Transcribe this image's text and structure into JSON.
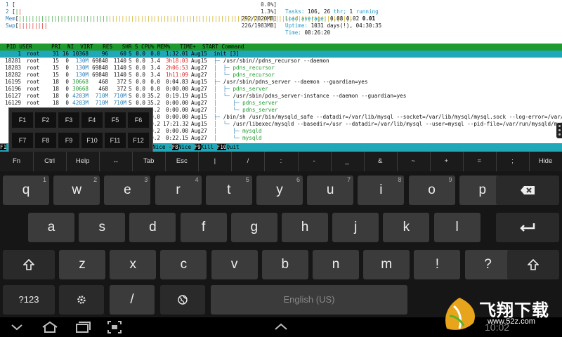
{
  "terminal": {
    "meters": [
      {
        "label": "1",
        "open": " [",
        "green": "",
        "red": "",
        "yellow": "",
        "close": "",
        "value": "0.0%]"
      },
      {
        "label": "2",
        "open": " [",
        "green": "|",
        "red": "|",
        "yellow": "",
        "close": "",
        "value": "1.3%]"
      },
      {
        "label": "Mem",
        "open": "[",
        "green": "||||||||||||||||||||||||||||",
        "red": "",
        "yellow": "||||||||||||||||||||||||||||||||||||||||||||||||||||||||||||||||||||||||||||",
        "close": "",
        "value": "292/2020MB]"
      },
      {
        "label": "Swp",
        "open": "[",
        "green": "",
        "red": "|||||||||",
        "yellow": "",
        "close": "",
        "value": "226/1983MB]"
      }
    ],
    "stats": {
      "tasks_label": "Tasks:",
      "tasks_value": "106,",
      "thr_value": "26",
      "thr_label": "thr;",
      "running_value": "1",
      "running_label": "running",
      "load_label": "Load average:",
      "load_values": "0.08 0.02",
      "load_last": "0.01",
      "uptime_label": "Uptime:",
      "uptime_value": "1031 days(!), 04:30:35",
      "time_label": "Time:",
      "time_value": "08:26:20"
    },
    "header": "  PID USER      PRI  NI  VIRT   RES   SHR S CPU% MEM%   TIME+  START Command",
    "processes": [
      {
        "pid": "1",
        "user": "root",
        "pri": "31",
        "ni": "16",
        "virt": "10368",
        "res": "96",
        "shr": "60",
        "s": "S",
        "cpu": "0.0",
        "mem": "0.0",
        "time": "1:32.01",
        "start": "Aug15",
        "cmd": "init [3]",
        "selected": true
      },
      {
        "pid": "18281",
        "user": "root",
        "pri": "15",
        "ni": "0",
        "virt": "130M",
        "res": "69848",
        "shr": "1140",
        "s": "S",
        "cpu": "0.0",
        "mem": "3.4",
        "time": "3h18:03",
        "start": "Aug15",
        "cmd": "/usr/sbin//pdns_recursor --daemon",
        "tree": "├─ "
      },
      {
        "pid": "18283",
        "user": "root",
        "pri": "15",
        "ni": "0",
        "virt": "130M",
        "res": "69848",
        "shr": "1140",
        "s": "S",
        "cpu": "0.0",
        "mem": "3.4",
        "time": "2h06:53",
        "start": "Aug27",
        "cmd": "pdns_recursor",
        "tree": "│  ├─ ",
        "green": true
      },
      {
        "pid": "18282",
        "user": "root",
        "pri": "15",
        "ni": "0",
        "virt": "130M",
        "res": "69848",
        "shr": "1140",
        "s": "S",
        "cpu": "0.0",
        "mem": "3.4",
        "time": "1h11:09",
        "start": "Aug27",
        "cmd": "pdns_recursor",
        "tree": "│  └─ ",
        "green": true
      },
      {
        "pid": "16195",
        "user": "root",
        "pri": "18",
        "ni": "0",
        "virt": "30668",
        "res": "468",
        "shr": "372",
        "s": "S",
        "cpu": "0.0",
        "mem": "0.0",
        "time": "0:04.83",
        "start": "Aug15",
        "cmd": "/usr/sbin/pdns_server --daemon --guardian=yes",
        "tree": "├─ "
      },
      {
        "pid": "16196",
        "user": "root",
        "pri": "18",
        "ni": "0",
        "virt": "30668",
        "res": "468",
        "shr": "372",
        "s": "S",
        "cpu": "0.0",
        "mem": "0.0",
        "time": "0:00.00",
        "start": "Aug27",
        "cmd": "pdns_server",
        "tree": "│  ├─ ",
        "green": true
      },
      {
        "pid": "16127",
        "user": "root",
        "pri": "18",
        "ni": "0",
        "virt": "4203M",
        "res": "710M",
        "shr": "710M",
        "s": "S",
        "cpu": "0.0",
        "mem": "35.2",
        "time": "0:19.19",
        "start": "Aug15",
        "cmd": "/usr/sbin/pdns_server-instance --daemon --guardian=yes",
        "tree": "│  └─ "
      },
      {
        "pid": "16129",
        "user": "root",
        "pri": "18",
        "ni": "0",
        "virt": "4203M",
        "res": "710M",
        "shr": "710M",
        "s": "S",
        "cpu": "0.0",
        "mem": "35.2",
        "time": "0:00.00",
        "start": "Aug27",
        "cmd": "pdns_server",
        "tree": "│     ├─ ",
        "green": true
      },
      {
        "pid": "",
        "user": "",
        "pri": "",
        "ni": "",
        "virt": "",
        "res": "",
        "shr": "",
        "s": "",
        "cpu": "",
        "mem": "35.2",
        "time": "0:00.00",
        "start": "Aug27",
        "cmd": "pdns_server",
        "tree": "│     └─ ",
        "green": true
      },
      {
        "pid": "",
        "user": "",
        "pri": "",
        "ni": "",
        "virt": "",
        "res": "",
        "shr": "",
        "s": "",
        "cpu": "",
        "mem": "0.0",
        "time": "0:00.00",
        "start": "Aug15",
        "cmd": "/bin/sh /usr/bin/mysqld_safe --datadir=/var/lib/mysql --socket=/var/lib/mysql/mysql.sock --log-error=/var/log/",
        "tree": "├─ "
      },
      {
        "pid": "",
        "user": "",
        "pri": "",
        "ni": "",
        "virt": "",
        "res": "",
        "shr": "",
        "s": "",
        "cpu": "",
        "mem": "0.2",
        "time": "17:21.32",
        "start": "Aug15",
        "cmd": "/usr/libexec/mysqld --basedir=/usr --datadir=/var/lib/mysql --user=mysql --pid-file=/var/run/mysqld/mysqld",
        "tree": "│  └─ "
      },
      {
        "pid": "",
        "user": "",
        "pri": "",
        "ni": "",
        "virt": "",
        "res": "",
        "shr": "",
        "s": "",
        "cpu": "",
        "mem": "0.2",
        "time": "0:00.00",
        "start": "Aug27",
        "cmd": "mysqld",
        "tree": "│     ├─ ",
        "green": true
      },
      {
        "pid": "",
        "user": "",
        "pri": "",
        "ni": "",
        "virt": "",
        "res": "",
        "shr": "",
        "s": "",
        "cpu": "",
        "mem": "0.2",
        "time": "0:22.15",
        "start": "Aug27",
        "cmd": "mysqld",
        "tree": "│     └─ ",
        "green": true
      }
    ],
    "fkeys_bar": [
      {
        "key": "F1",
        "label": ""
      },
      {
        "key": "F8",
        "label": "Nice "
      },
      {
        "key": "F9",
        "label": "Kill "
      },
      {
        "key": "F10",
        "label": "Quit"
      }
    ],
    "fkeys_bar_prefix": "Nice -"
  },
  "fkey_popup": [
    "F1",
    "F2",
    "F3",
    "F4",
    "F5",
    "F6",
    "F7",
    "F8",
    "F9",
    "F10",
    "F11",
    "F12"
  ],
  "extra_keys": [
    "Fn",
    "Ctrl",
    "Help",
    "↔",
    "Tab",
    "Esc",
    "|",
    "/",
    ":",
    "-",
    "_",
    "&",
    "~",
    "+",
    "=",
    ";",
    "Hide"
  ],
  "keyboard": {
    "row1": [
      {
        "k": "q",
        "h": "1"
      },
      {
        "k": "w",
        "h": "2"
      },
      {
        "k": "e",
        "h": "3"
      },
      {
        "k": "r",
        "h": "4"
      },
      {
        "k": "t",
        "h": "5"
      },
      {
        "k": "y",
        "h": "6"
      },
      {
        "k": "u",
        "h": "7"
      },
      {
        "k": "i",
        "h": "8"
      },
      {
        "k": "o",
        "h": "9"
      },
      {
        "k": "p",
        "h": "0"
      }
    ],
    "row2": [
      {
        "k": "a",
        "h": ""
      },
      {
        "k": "s",
        "h": ""
      },
      {
        "k": "d",
        "h": ""
      },
      {
        "k": "f",
        "h": ""
      },
      {
        "k": "g",
        "h": ""
      },
      {
        "k": "h",
        "h": ""
      },
      {
        "k": "j",
        "h": ""
      },
      {
        "k": "k",
        "h": ""
      },
      {
        "k": "l",
        "h": ""
      }
    ],
    "row3": [
      {
        "k": "z",
        "h": ""
      },
      {
        "k": "x",
        "h": ""
      },
      {
        "k": "c",
        "h": ""
      },
      {
        "k": "v",
        "h": ""
      },
      {
        "k": "b",
        "h": ""
      },
      {
        "k": "n",
        "h": ""
      },
      {
        "k": "m",
        "h": ""
      },
      {
        "k": "!",
        "h": ""
      },
      {
        "k": "?",
        "h": ""
      }
    ],
    "symbols_label": "?123",
    "slash_label": "/",
    "space_label": "English (US)",
    "backspace_icon": "backspace-icon",
    "enter_icon": "enter-icon",
    "shift_icon": "shift-icon",
    "settings_icon": "gear-icon",
    "globe_icon": "globe-icon"
  },
  "navbar": {
    "clock": "10:02",
    "watermark_text": "飞翔下载",
    "watermark_url": "www.52z.com"
  }
}
